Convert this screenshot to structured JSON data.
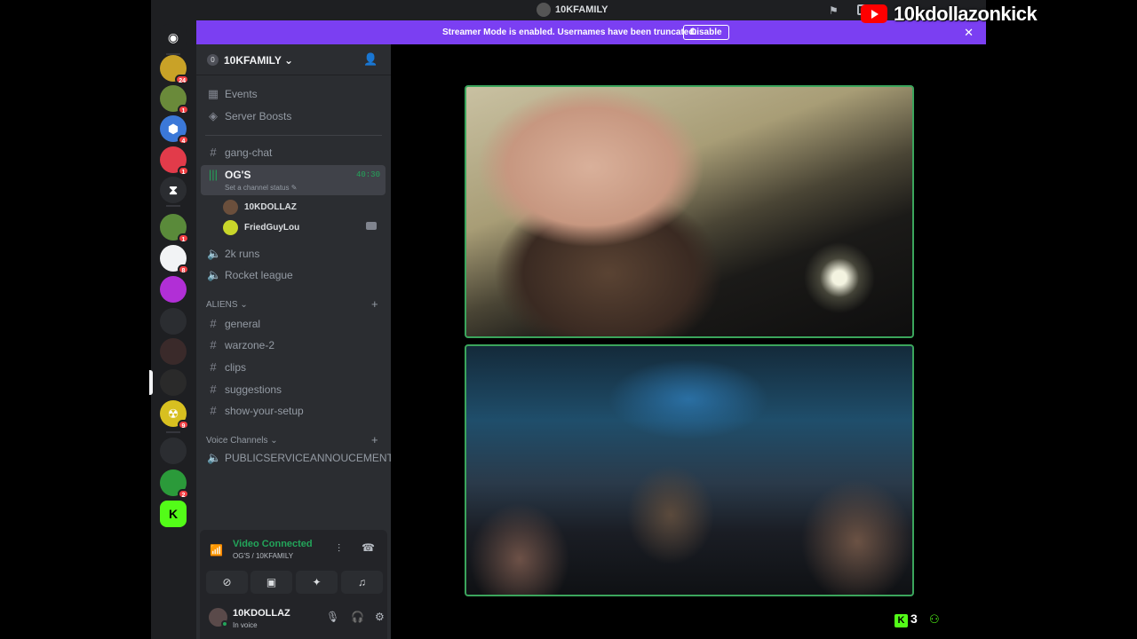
{
  "window": {
    "title": "10KFAMILY"
  },
  "banner": {
    "message": "Streamer Mode is enabled. Usernames have been truncated.",
    "disable_label": "Disable"
  },
  "servers": [
    {
      "name": "discord-home",
      "badge": "",
      "color": "#1e1f22",
      "glyph": "◉"
    },
    {
      "name": "server-1",
      "badge": "24",
      "color": "#c9a227",
      "glyph": ""
    },
    {
      "name": "server-2",
      "badge": "1",
      "color": "#6a8a3a",
      "glyph": ""
    },
    {
      "name": "server-3",
      "badge": "4",
      "color": "#3b78d8",
      "glyph": "⬢"
    },
    {
      "name": "server-4",
      "badge": "1",
      "color": "#e23b4a",
      "glyph": ""
    },
    {
      "name": "server-5",
      "badge": "",
      "color": "#2b2d31",
      "glyph": "⧗"
    },
    {
      "name": "server-6",
      "badge": "1",
      "color": "#5a8a3a",
      "glyph": ""
    },
    {
      "name": "server-7",
      "badge": "8",
      "color": "#f2f3f5",
      "glyph": ""
    },
    {
      "name": "server-8",
      "badge": "",
      "color": "#b12fd6",
      "glyph": ""
    },
    {
      "name": "server-9",
      "badge": "",
      "color": "#2b2d31",
      "glyph": ""
    },
    {
      "name": "server-10",
      "badge": "",
      "color": "#3a2a2a",
      "glyph": ""
    },
    {
      "name": "server-11",
      "badge": "",
      "color": "#2a2a2a",
      "glyph": ""
    },
    {
      "name": "server-12",
      "badge": "9",
      "color": "#d8c020",
      "glyph": "☢"
    },
    {
      "name": "server-13",
      "badge": "",
      "color": "#2b2d31",
      "glyph": ""
    },
    {
      "name": "server-14",
      "badge": "2",
      "color": "#2b9a3a",
      "glyph": ""
    },
    {
      "name": "server-kick",
      "badge": "",
      "color": "#53fc18",
      "glyph": "K"
    }
  ],
  "guild": {
    "name": "10KFAMILY",
    "level": "0"
  },
  "top_items": [
    {
      "icon": "calendar-icon",
      "label": "Events"
    },
    {
      "icon": "boost-icon",
      "label": "Server Boosts"
    }
  ],
  "channels": {
    "gang_chat": "gang-chat",
    "ogs": {
      "label": "OG'S",
      "timer": "40:30",
      "status": "Set a channel status"
    },
    "voice_users": [
      {
        "name": "10KDOLLAZ"
      },
      {
        "name": "FriedGuyLou"
      }
    ],
    "k2_runs": "2k runs",
    "rocket_league": "Rocket league",
    "aliens_category": "ALIENS",
    "aliens": [
      "general",
      "warzone-2",
      "clips",
      "suggestions",
      "show-your-setup"
    ],
    "voice_category": "Voice Channels",
    "voice_channels": [
      "PUBLICSERVICEANNOUCEMENT"
    ]
  },
  "voice_panel": {
    "title": "Video Connected",
    "subtitle": "OG'S / 10KFAMILY"
  },
  "user_panel": {
    "name": "10KDOLLAZ",
    "status": "In voice"
  },
  "overlay": {
    "channel": "10kdollazonkick"
  },
  "kick_viewers": {
    "count": "3"
  },
  "colors": {
    "accent_green": "#23a55a",
    "banner": "#7b3ff2",
    "kick_green": "#53fc18"
  }
}
